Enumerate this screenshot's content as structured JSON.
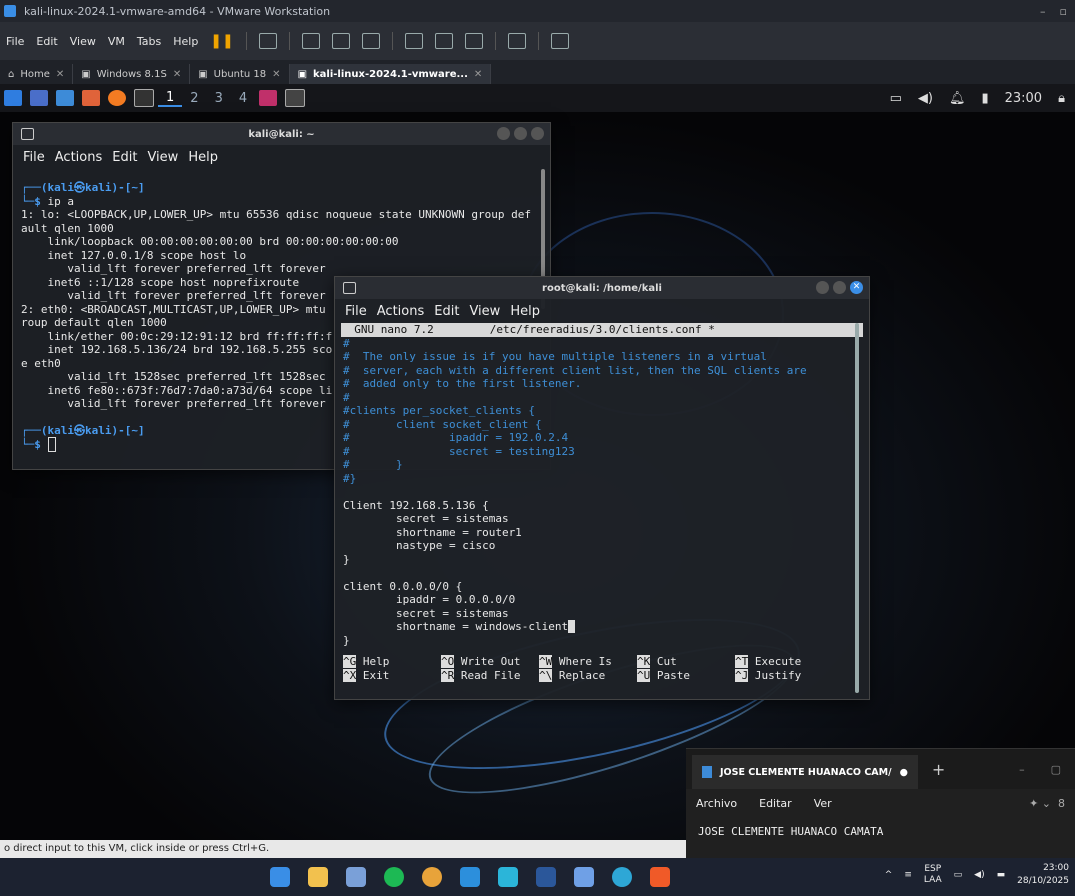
{
  "vmware": {
    "title": "kali-linux-2024.1-vmware-amd64 - VMware Workstation",
    "menu": [
      "File",
      "Edit",
      "View",
      "VM",
      "Tabs",
      "Help"
    ],
    "tabs": [
      {
        "label": "Home"
      },
      {
        "label": "Windows 8.1S"
      },
      {
        "label": "Ubuntu 18"
      },
      {
        "label": "kali-linux-2024.1-vmware..."
      }
    ],
    "status_text": "o direct input to this VM, click inside or press Ctrl+G."
  },
  "kali_panel": {
    "workspaces": [
      "1",
      "2",
      "3",
      "4"
    ],
    "time": "23:00"
  },
  "terminal1": {
    "title": "kali@kali: ~",
    "menu": [
      "File",
      "Actions",
      "Edit",
      "View",
      "Help"
    ],
    "lines": [
      "1: lo: <LOOPBACK,UP,LOWER_UP> mtu 65536 qdisc noqueue state UNKNOWN group def",
      "ault qlen 1000",
      "    link/loopback 00:00:00:00:00:00 brd 00:00:00:00:00:00",
      "    inet 127.0.0.1/8 scope host lo",
      "       valid_lft forever preferred_lft forever",
      "    inet6 ::1/128 scope host noprefixroute",
      "       valid_lft forever preferred_lft forever",
      "2: eth0: <BROADCAST,MULTICAST,UP,LOWER_UP> mtu",
      "roup default qlen 1000",
      "    link/ether 00:0c:29:12:91:12 brd ff:ff:ff:f",
      "    inet 192.168.5.136/24 brd 192.168.5.255 sco",
      "e eth0",
      "       valid_lft 1528sec preferred_lft 1528sec",
      "    inet6 fe80::673f:76d7:7da0:a73d/64 scope li",
      "       valid_lft forever preferred_lft forever"
    ],
    "prompt_user": "(kali㉿kali)-[~]",
    "command": "ip a"
  },
  "terminal2": {
    "title": "root@kali: /home/kali",
    "menu": [
      "File",
      "Actions",
      "Edit",
      "View",
      "Help"
    ],
    "nano_header_left": "  GNU nano 7.2",
    "nano_header_file": "/etc/freeradius/3.0/clients.conf *",
    "comment_lines": [
      "#",
      "#  The only issue is if you have multiple listeners in a virtual",
      "#  server, each with a different client list, then the SQL clients are",
      "#  added only to the first listener.",
      "#",
      "#clients per_socket_clients {",
      "#       client socket_client {",
      "#               ipaddr = 192.0.2.4",
      "#               secret = testing123",
      "#       }",
      "#}"
    ],
    "body_lines": [
      "",
      "Client 192.168.5.136 {",
      "        secret = sistemas",
      "        shortname = router1",
      "        nastype = cisco",
      "}",
      "",
      "client 0.0.0.0/0 {",
      "        ipaddr = 0.0.0.0/0",
      "        secret = sistemas",
      "        shortname = windows-client",
      "}"
    ],
    "shortcuts_row1": [
      {
        "key": "^G",
        "label": "Help"
      },
      {
        "key": "^O",
        "label": "Write Out"
      },
      {
        "key": "^W",
        "label": "Where Is"
      },
      {
        "key": "^K",
        "label": "Cut"
      },
      {
        "key": "^T",
        "label": "Execute"
      }
    ],
    "shortcuts_row2": [
      {
        "key": "^X",
        "label": "Exit"
      },
      {
        "key": "^R",
        "label": "Read File"
      },
      {
        "key": "^\\",
        "label": "Replace"
      },
      {
        "key": "^U",
        "label": "Paste"
      },
      {
        "key": "^J",
        "label": "Justify"
      }
    ]
  },
  "notepad": {
    "tab_title": "JOSE CLEMENTE HUANACO CAM/",
    "menu": [
      "Archivo",
      "Editar",
      "Ver"
    ],
    "content": "JOSE CLEMENTE HUANACO CAMATA"
  },
  "taskbar": {
    "lang": "ESP",
    "lang2": "LAA",
    "time": "23:00",
    "date": "28/10/2025"
  }
}
